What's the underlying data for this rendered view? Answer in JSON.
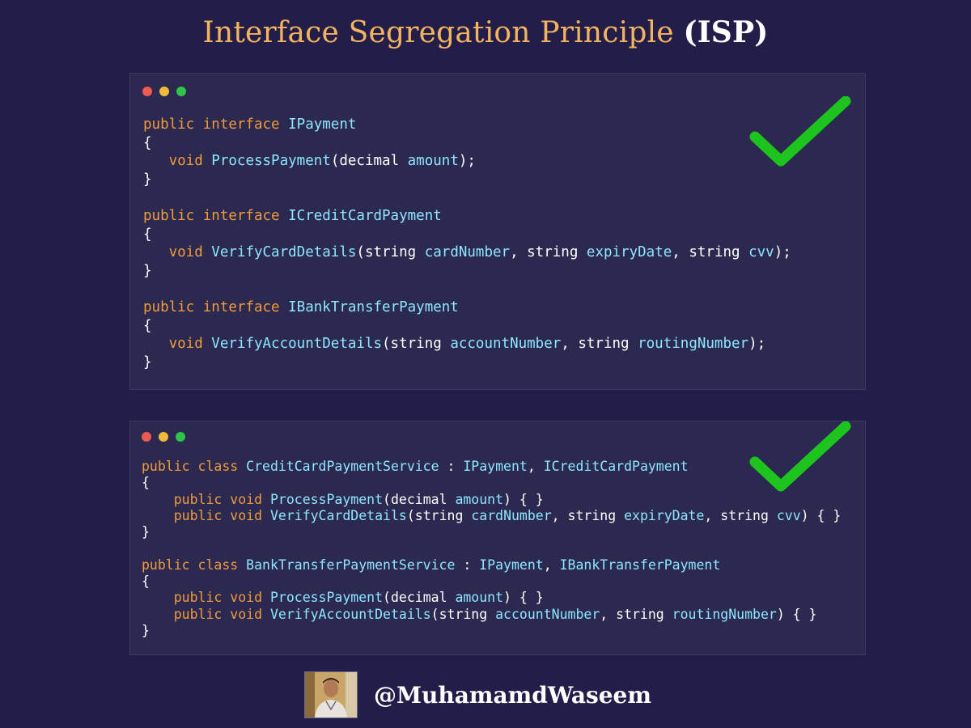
{
  "title": {
    "main": "Interface Segregation Principle",
    "abbr": "(ISP)"
  },
  "colors": {
    "background": "#231d49",
    "panel": "#2b2950",
    "title_accent": "#f4b35e",
    "keyword": "#f29a3c",
    "type": "#8fe6ff",
    "check": "#1ec41e"
  },
  "window_controls": [
    "close-dot-red",
    "minimize-dot-yellow",
    "maximize-dot-green"
  ],
  "panels": [
    {
      "icon": "checkmark-icon",
      "lines": [
        [
          {
            "t": "public interface ",
            "c": "kw"
          },
          {
            "t": "IPayment",
            "c": "ty"
          }
        ],
        [
          {
            "t": "{",
            "c": ""
          }
        ],
        [
          {
            "t": "   void ",
            "c": "kw"
          },
          {
            "t": "ProcessPayment",
            "c": "ty"
          },
          {
            "t": "(decimal ",
            "c": ""
          },
          {
            "t": "amount",
            "c": "ty"
          },
          {
            "t": ");",
            "c": ""
          }
        ],
        [
          {
            "t": "}",
            "c": ""
          }
        ],
        [
          {
            "t": "",
            "c": ""
          }
        ],
        [
          {
            "t": "public interface ",
            "c": "kw"
          },
          {
            "t": "ICreditCardPayment",
            "c": "ty"
          }
        ],
        [
          {
            "t": "{",
            "c": ""
          }
        ],
        [
          {
            "t": "   void ",
            "c": "kw"
          },
          {
            "t": "VerifyCardDetails",
            "c": "ty"
          },
          {
            "t": "(string ",
            "c": ""
          },
          {
            "t": "cardNumber",
            "c": "ty"
          },
          {
            "t": ", string ",
            "c": ""
          },
          {
            "t": "expiryDate",
            "c": "ty"
          },
          {
            "t": ", string ",
            "c": ""
          },
          {
            "t": "cvv",
            "c": "ty"
          },
          {
            "t": ");",
            "c": ""
          }
        ],
        [
          {
            "t": "}",
            "c": ""
          }
        ],
        [
          {
            "t": "",
            "c": ""
          }
        ],
        [
          {
            "t": "public interface ",
            "c": "kw"
          },
          {
            "t": "IBankTransferPayment",
            "c": "ty"
          }
        ],
        [
          {
            "t": "{",
            "c": ""
          }
        ],
        [
          {
            "t": "   void ",
            "c": "kw"
          },
          {
            "t": "VerifyAccountDetails",
            "c": "ty"
          },
          {
            "t": "(string ",
            "c": ""
          },
          {
            "t": "accountNumber",
            "c": "ty"
          },
          {
            "t": ", string ",
            "c": ""
          },
          {
            "t": "routingNumber",
            "c": "ty"
          },
          {
            "t": ");",
            "c": ""
          }
        ],
        [
          {
            "t": "}",
            "c": ""
          }
        ]
      ]
    },
    {
      "icon": "checkmark-icon",
      "lines": [
        [
          {
            "t": "public class ",
            "c": "kw"
          },
          {
            "t": "CreditCardPaymentService",
            "c": "ty"
          },
          {
            "t": " : ",
            "c": ""
          },
          {
            "t": "IPayment",
            "c": "ty"
          },
          {
            "t": ", ",
            "c": ""
          },
          {
            "t": "ICreditCardPayment",
            "c": "ty"
          }
        ],
        [
          {
            "t": "{",
            "c": ""
          }
        ],
        [
          {
            "t": "    public void ",
            "c": "kw"
          },
          {
            "t": "ProcessPayment",
            "c": "ty"
          },
          {
            "t": "(decimal ",
            "c": ""
          },
          {
            "t": "amount",
            "c": "ty"
          },
          {
            "t": ") { }",
            "c": ""
          }
        ],
        [
          {
            "t": "    public void ",
            "c": "kw"
          },
          {
            "t": "VerifyCardDetails",
            "c": "ty"
          },
          {
            "t": "(string ",
            "c": ""
          },
          {
            "t": "cardNumber",
            "c": "ty"
          },
          {
            "t": ", string ",
            "c": ""
          },
          {
            "t": "expiryDate",
            "c": "ty"
          },
          {
            "t": ", string ",
            "c": ""
          },
          {
            "t": "cvv",
            "c": "ty"
          },
          {
            "t": ") { }",
            "c": ""
          }
        ],
        [
          {
            "t": "}",
            "c": ""
          }
        ],
        [
          {
            "t": "",
            "c": ""
          }
        ],
        [
          {
            "t": "public class ",
            "c": "kw"
          },
          {
            "t": "BankTransferPaymentService",
            "c": "ty"
          },
          {
            "t": " : ",
            "c": ""
          },
          {
            "t": "IPayment",
            "c": "ty"
          },
          {
            "t": ", ",
            "c": ""
          },
          {
            "t": "IBankTransferPayment",
            "c": "ty"
          }
        ],
        [
          {
            "t": "{",
            "c": ""
          }
        ],
        [
          {
            "t": "    public void ",
            "c": "kw"
          },
          {
            "t": "ProcessPayment",
            "c": "ty"
          },
          {
            "t": "(decimal ",
            "c": ""
          },
          {
            "t": "amount",
            "c": "ty"
          },
          {
            "t": ") { }",
            "c": ""
          }
        ],
        [
          {
            "t": "    public void ",
            "c": "kw"
          },
          {
            "t": "VerifyAccountDetails",
            "c": "ty"
          },
          {
            "t": "(string ",
            "c": ""
          },
          {
            "t": "accountNumber",
            "c": "ty"
          },
          {
            "t": ", string ",
            "c": ""
          },
          {
            "t": "routingNumber",
            "c": "ty"
          },
          {
            "t": ") { }",
            "c": ""
          }
        ],
        [
          {
            "t": "}",
            "c": ""
          }
        ]
      ]
    }
  ],
  "footer": {
    "avatar": "author-avatar-photo",
    "handle": "@MuhamamdWaseem"
  }
}
